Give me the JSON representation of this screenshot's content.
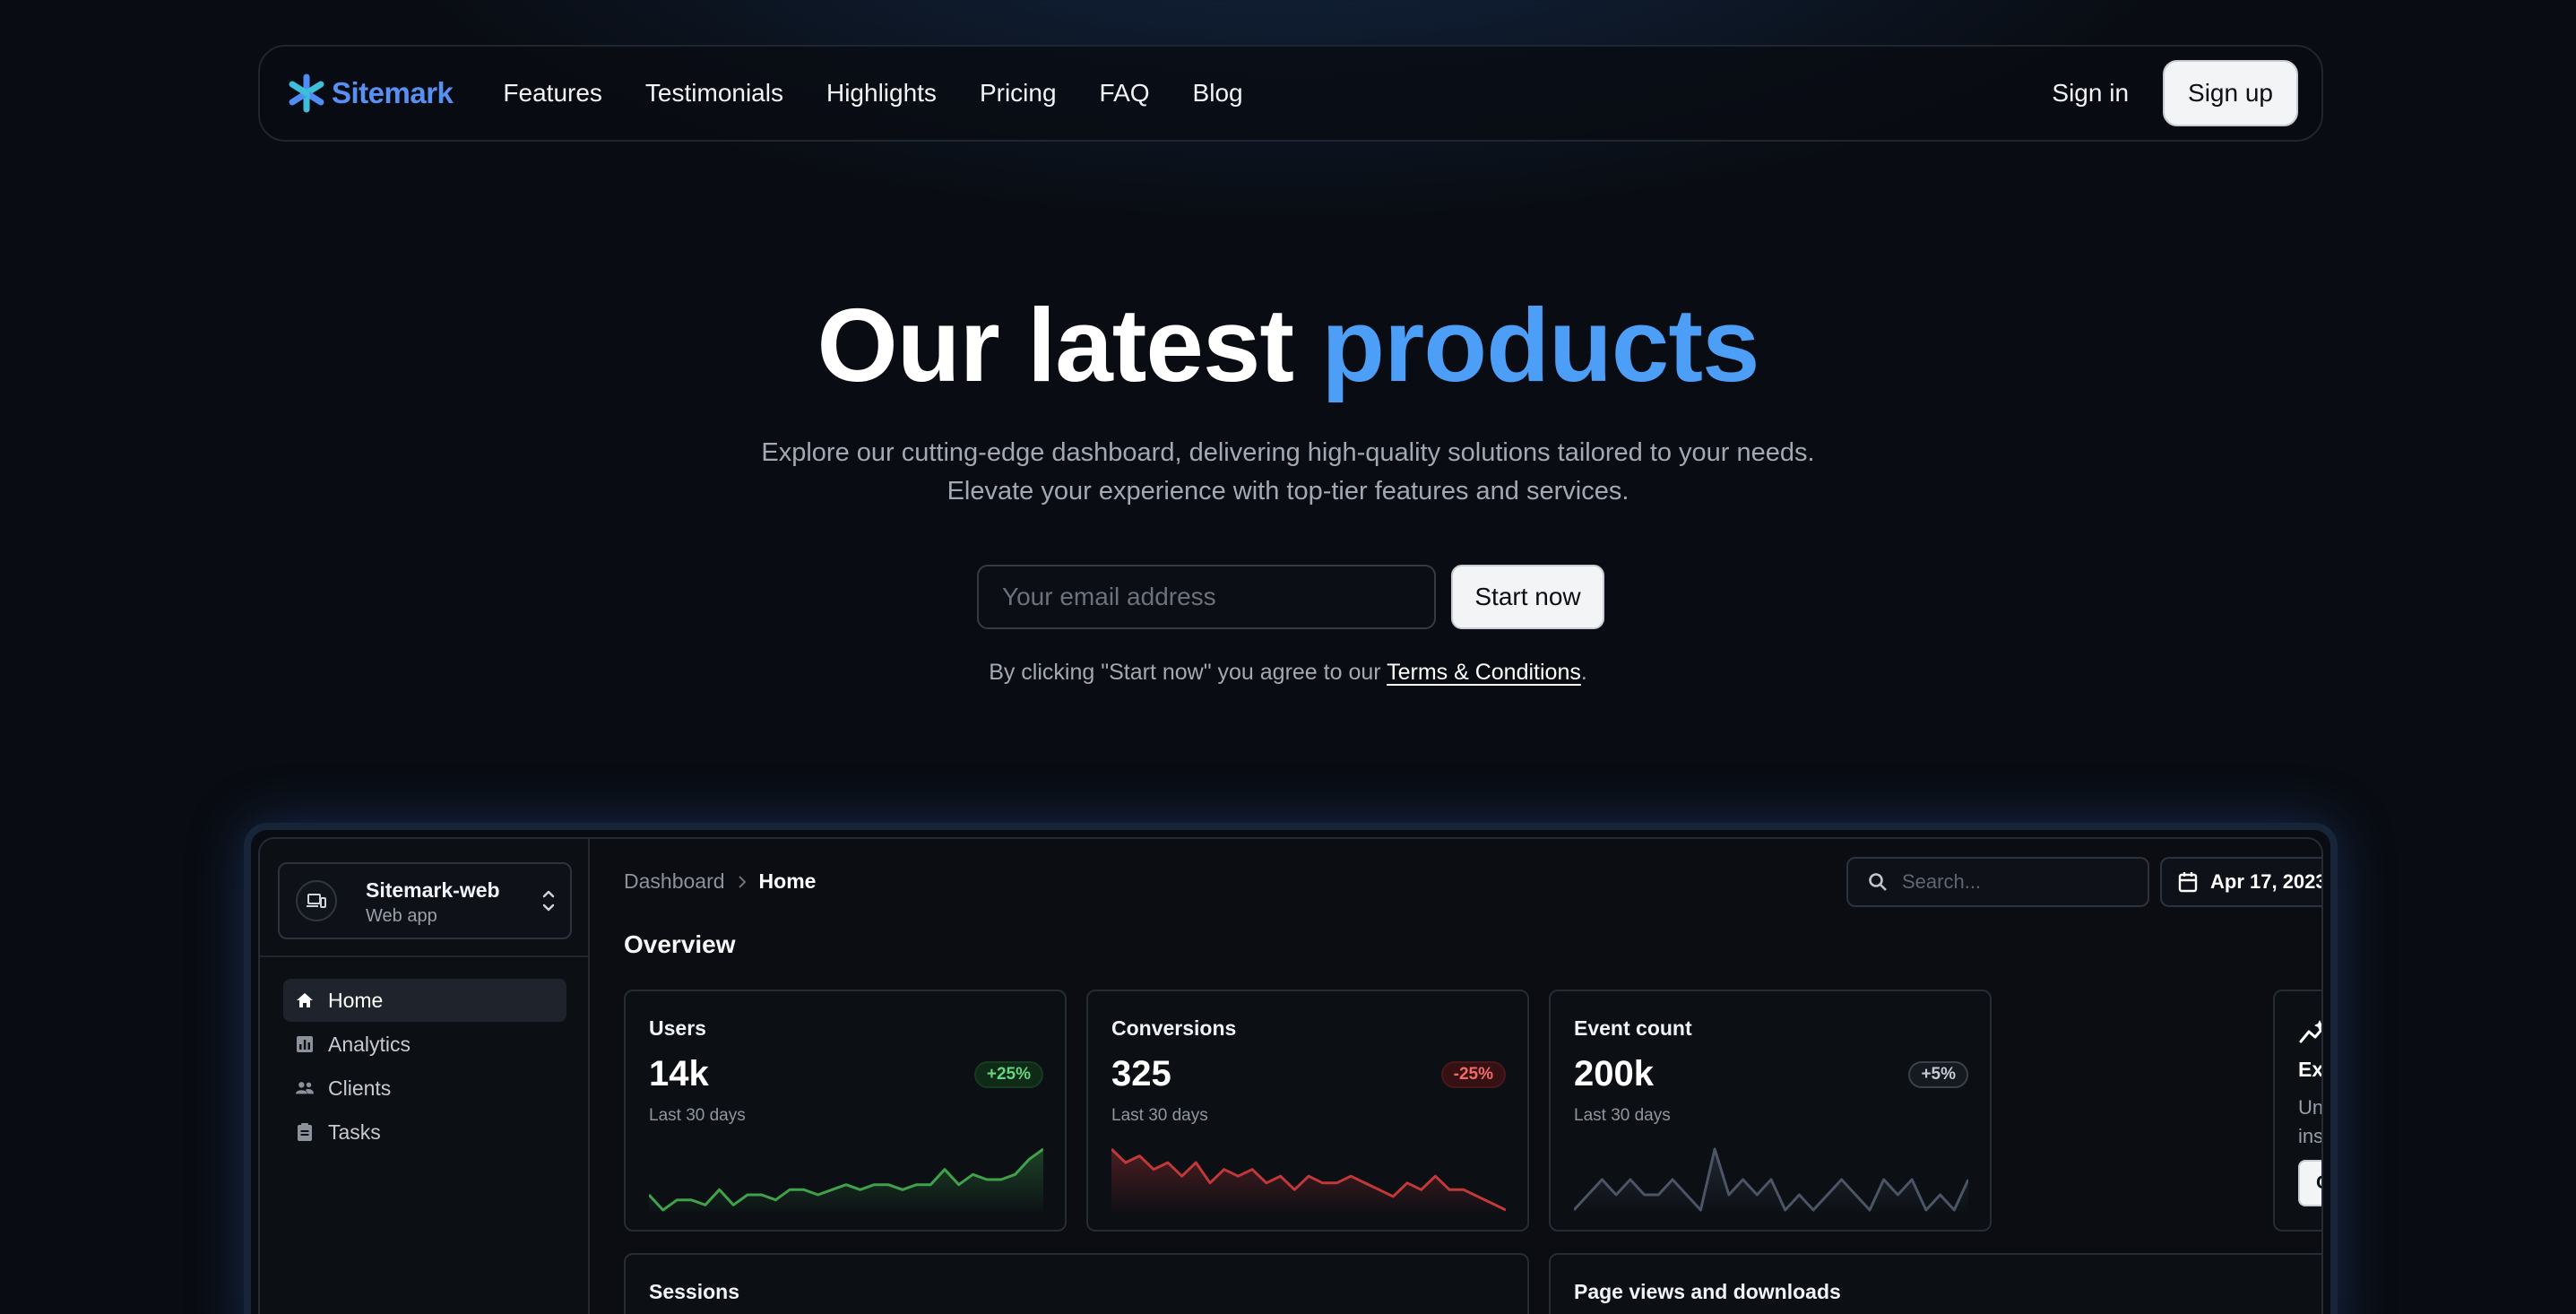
{
  "nav": {
    "brand": "Sitemark",
    "links": [
      "Features",
      "Testimonials",
      "Highlights",
      "Pricing",
      "FAQ",
      "Blog"
    ],
    "sign_in": "Sign in",
    "sign_up": "Sign up"
  },
  "hero": {
    "title_plain": "Our latest",
    "title_accent": "products",
    "subtitle_line1": "Explore our cutting-edge dashboard, delivering high-quality solutions tailored to your needs.",
    "subtitle_line2": "Elevate your experience with top-tier features and services.",
    "email_placeholder": "Your email address",
    "email_value": "",
    "start_button": "Start now",
    "terms_prefix": "By clicking \"Start now\" you agree to our ",
    "terms_link": "Terms & Conditions",
    "terms_suffix": "."
  },
  "dashboard": {
    "app_name": "Sitemark-web",
    "app_type": "Web app",
    "menu": [
      "Home",
      "Analytics",
      "Clients",
      "Tasks"
    ],
    "breadcrumb": [
      "Dashboard",
      "Home"
    ],
    "search_placeholder": "Search...",
    "date": "Apr 17, 2023",
    "overview_title": "Overview",
    "cards": [
      {
        "title": "Users",
        "value": "14k",
        "subtitle": "Last 30 days",
        "badge": "+25%",
        "trend": "up",
        "color": "#3fa24a",
        "spark": [
          4,
          1,
          3,
          3,
          2,
          5,
          2,
          4,
          4,
          3,
          5,
          5,
          4,
          5,
          6,
          5,
          6,
          6,
          5,
          6,
          6,
          9,
          6,
          8,
          7,
          7,
          8,
          11,
          13
        ]
      },
      {
        "title": "Conversions",
        "value": "325",
        "subtitle": "Last 30 days",
        "badge": "-25%",
        "trend": "down",
        "color": "#c23838",
        "spark": [
          11,
          9,
          10,
          8,
          9,
          7,
          9,
          6,
          8,
          7,
          8,
          6,
          7,
          5,
          7,
          6,
          6,
          7,
          6,
          5,
          4,
          6,
          5,
          7,
          5,
          5,
          4,
          3,
          2
        ]
      },
      {
        "title": "Event count",
        "value": "200k",
        "subtitle": "Last 30 days",
        "badge": "+5%",
        "trend": "flat",
        "color": "#4b5566",
        "spark": [
          5,
          6,
          7,
          6,
          7,
          6,
          6,
          7,
          6,
          5,
          9,
          6,
          7,
          6,
          7,
          5,
          6,
          5,
          6,
          7,
          6,
          5,
          7,
          6,
          7,
          5,
          6,
          5,
          7
        ]
      }
    ],
    "explore": {
      "title": "Explore your data",
      "description": "Uncover performance and visitor insights with our data wizardry.",
      "button": "Get insights"
    },
    "bottom_cards": [
      "Sessions",
      "Page views and downloads"
    ]
  },
  "colors": {
    "accent": "#4d9ef7",
    "brand": "#5a8ff2",
    "background": "#090c12"
  }
}
